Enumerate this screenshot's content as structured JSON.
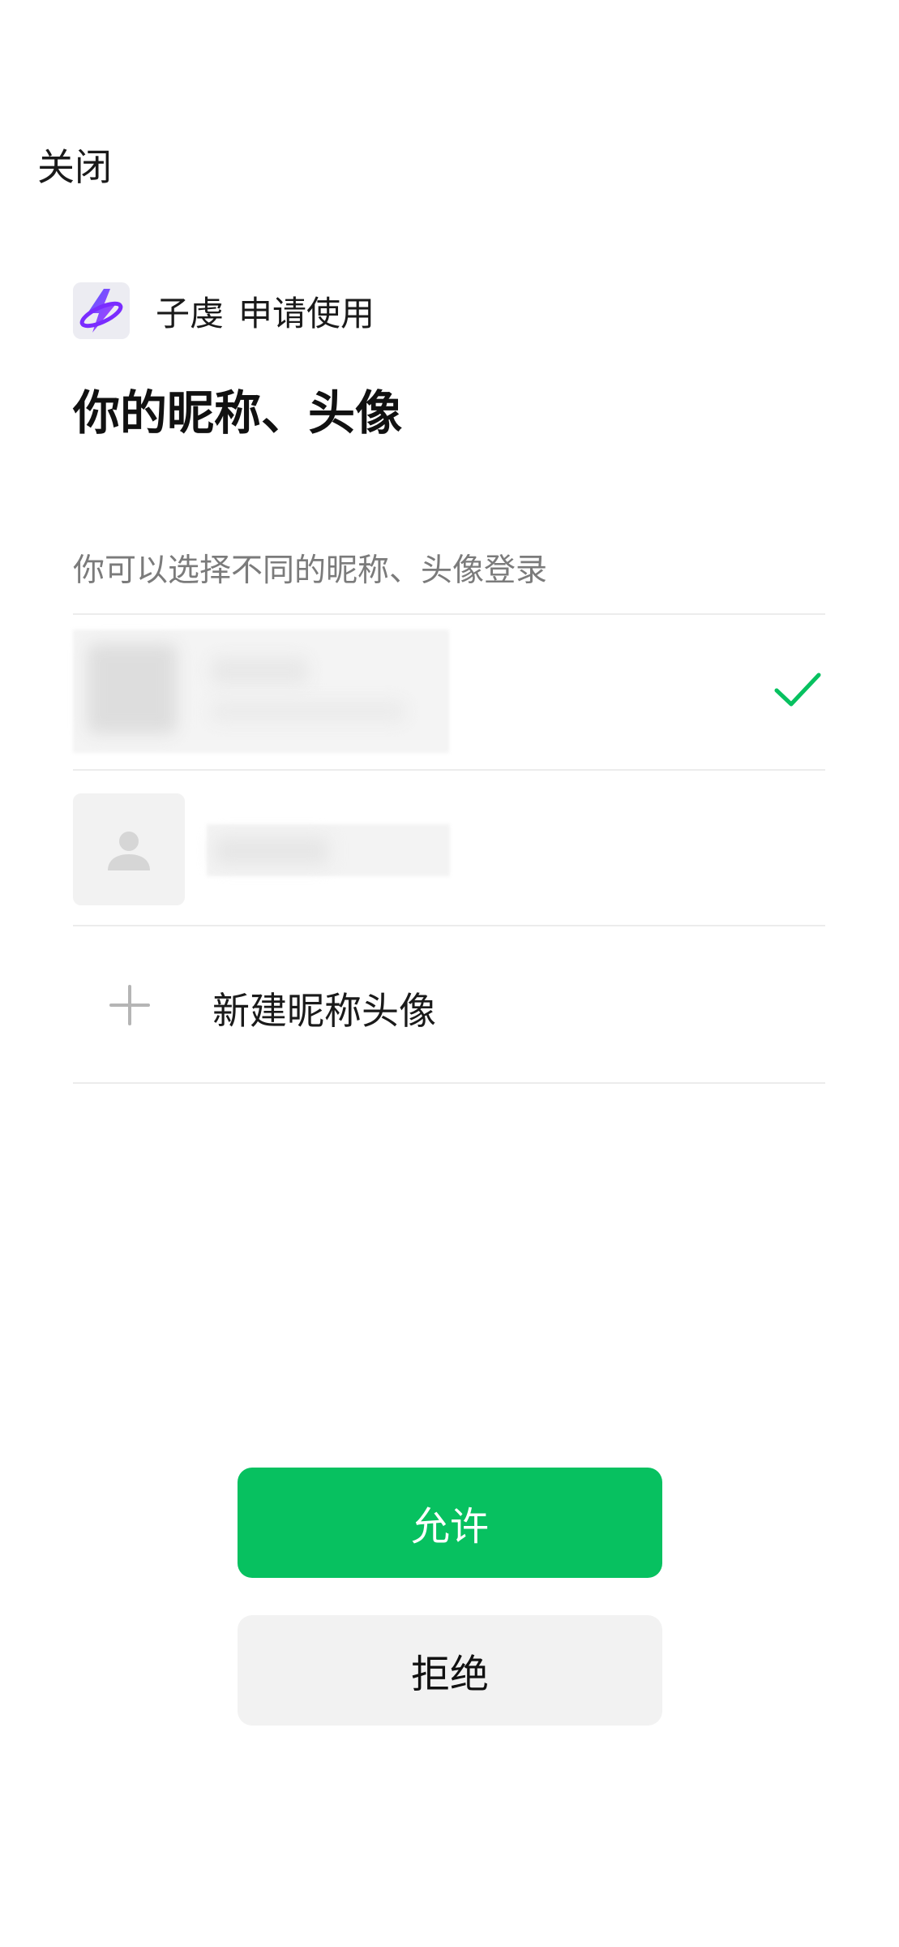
{
  "header": {
    "close_label": "关闭"
  },
  "app": {
    "name": "子虔",
    "request_text": "申请使用",
    "logo_icon": "app-logo-icon"
  },
  "page": {
    "title": "你的昵称、头像",
    "hint": "你可以选择不同的昵称、头像登录"
  },
  "profiles": [
    {
      "selected": true,
      "check_icon": "checkmark-icon"
    },
    {
      "selected": false,
      "avatar_icon": "person-placeholder-icon"
    }
  ],
  "new_profile": {
    "label": "新建昵称头像",
    "icon": "plus-icon"
  },
  "actions": {
    "allow_label": "允许",
    "deny_label": "拒绝"
  },
  "colors": {
    "accent": "#07c160",
    "secondary_button": "#f2f2f2",
    "hint_text": "#7b7b7b"
  }
}
